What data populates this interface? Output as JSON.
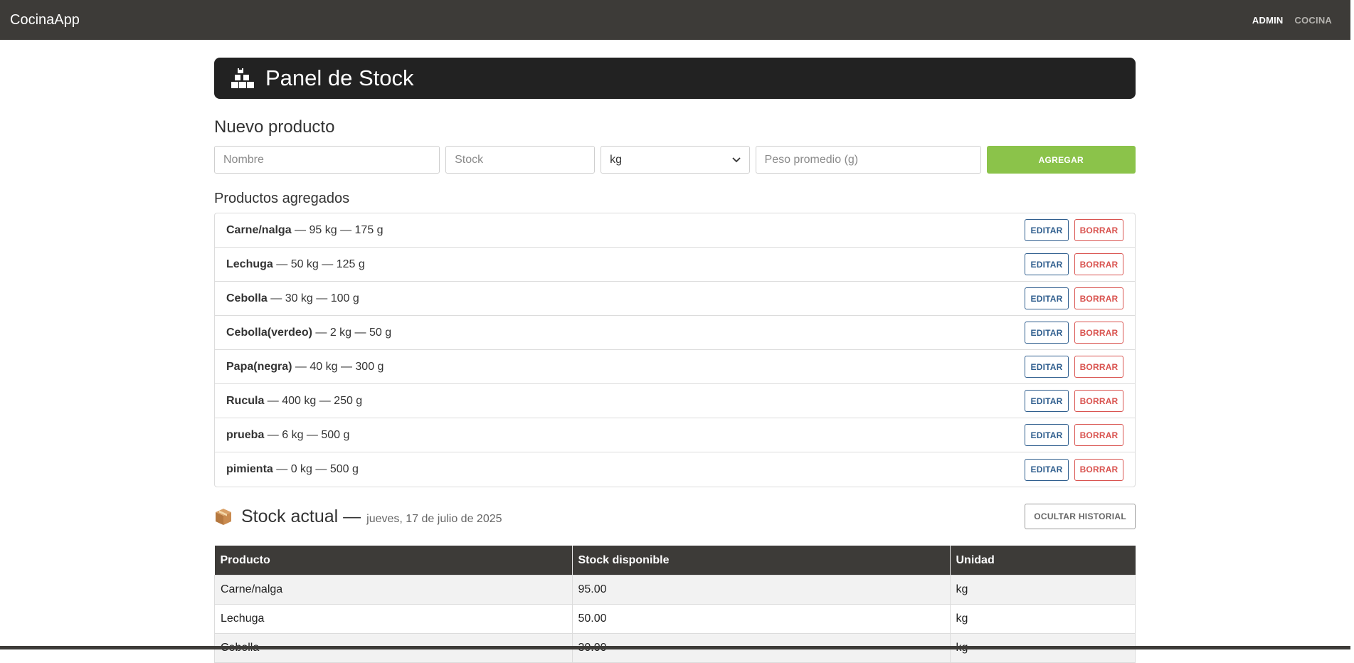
{
  "nav": {
    "brand": "CocinaApp",
    "links": [
      "ADMIN",
      "COCINA"
    ]
  },
  "header": {
    "icon": "boxes-icon",
    "title": "Panel de Stock"
  },
  "new_product": {
    "title": "Nuevo producto",
    "name_placeholder": "Nombre",
    "stock_placeholder": "Stock",
    "unit_value": "kg",
    "weight_placeholder": "Peso promedio (g)",
    "add_label": "AGREGAR",
    "accent_color": "#8bc34a"
  },
  "products": {
    "title": "Productos agregados",
    "edit_label": "EDITAR",
    "delete_label": "BORRAR",
    "items": [
      {
        "name": "Carne/nalga",
        "details": " — 95 kg — 175 g"
      },
      {
        "name": "Lechuga",
        "details": " — 50 kg — 125 g"
      },
      {
        "name": "Cebolla",
        "details": " — 30 kg — 100 g"
      },
      {
        "name": "Cebolla(verdeo)",
        "details": " — 2 kg — 50 g"
      },
      {
        "name": "Papa(negra)",
        "details": " — 40 kg — 300 g"
      },
      {
        "name": "Rucula",
        "details": " — 400 kg — 250 g"
      },
      {
        "name": "prueba",
        "details": " — 6 kg — 500 g"
      },
      {
        "name": "pimienta",
        "details": " — 0 kg — 500 g"
      }
    ]
  },
  "stock": {
    "icon": "package-icon",
    "title": "Stock actual —",
    "date": "jueves, 17 de julio de 2025",
    "history_label": "OCULTAR HISTORIAL",
    "columns": [
      "Producto",
      "Stock disponible",
      "Unidad"
    ],
    "rows": [
      [
        "Carne/nalga",
        "95.00",
        "kg"
      ],
      [
        "Lechuga",
        "50.00",
        "kg"
      ],
      [
        "Cebolla",
        "30.00",
        "kg"
      ]
    ]
  }
}
